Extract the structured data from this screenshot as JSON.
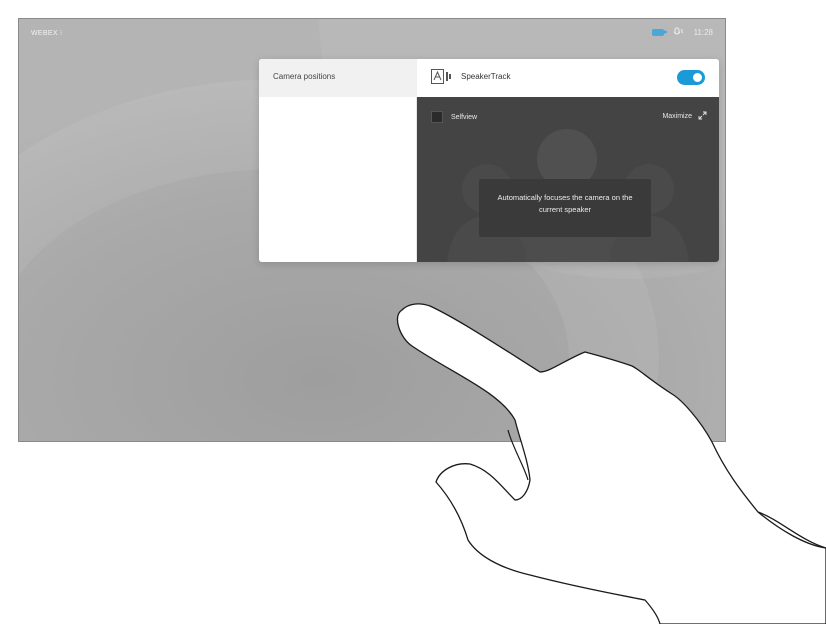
{
  "statusbar": {
    "device_name": "WEBEX ⁝",
    "time": "11:28",
    "icons": [
      "camera-icon",
      "microphone-icon"
    ]
  },
  "camera_panel": {
    "menu_item": "Camera positions",
    "speakertrack_label": "SpeakerTrack",
    "speakertrack_enabled": true,
    "selfview_label": "Selfview",
    "maximize_label": "Maximize",
    "tooltip": "Automatically focuses the camera on the current speaker"
  },
  "colors": {
    "accent": "#1a9ad6",
    "preview_bg": "#444444",
    "screen_bg": "#a9a9a9"
  }
}
